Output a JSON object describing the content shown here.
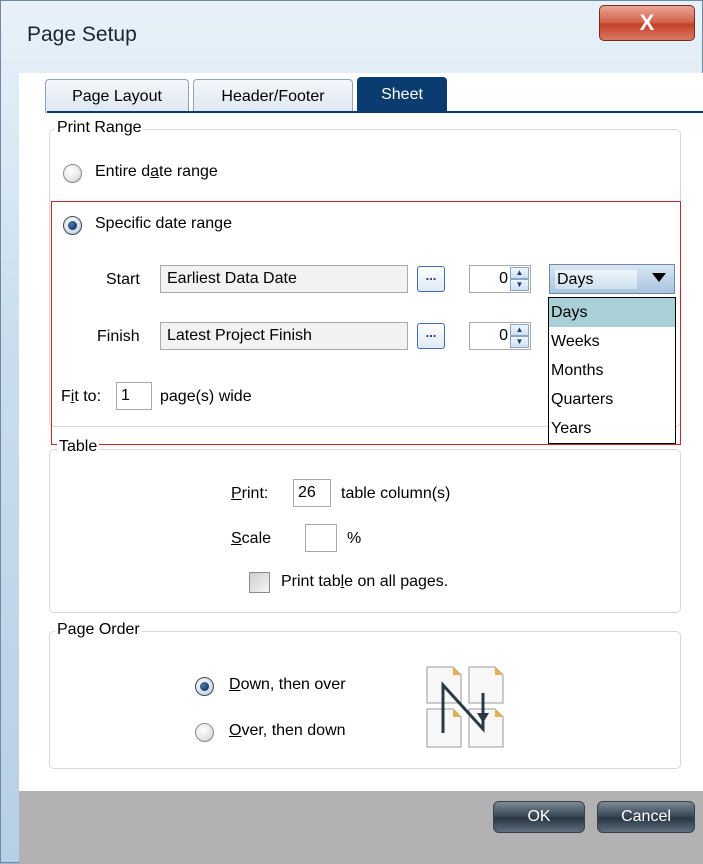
{
  "window": {
    "title": "Page Setup",
    "close_label": "X"
  },
  "tabs": [
    {
      "label": "Page Layout",
      "active": false
    },
    {
      "label": "Header/Footer",
      "active": false
    },
    {
      "label": "Sheet",
      "active": true
    }
  ],
  "print_range": {
    "legend": "Print Range",
    "entire_pre": "Entire d",
    "entire_u": "a",
    "entire_post": "te range",
    "entire_checked": false,
    "specific_label": "Specific date range",
    "specific_checked": true,
    "start_label": "Start",
    "start_value": "Earliest Data Date",
    "start_spin": "0",
    "finish_label": "Finish",
    "finish_value": "Latest Project Finish",
    "finish_spin": "0",
    "ellipsis": "...",
    "unit_selected": "Days",
    "unit_options": [
      "Days",
      "Weeks",
      "Months",
      "Quarters",
      "Years"
    ],
    "fit_pre": "F",
    "fit_u": "i",
    "fit_post": "t to:",
    "fit_value": "1",
    "fit_suffix": "page(s) wide"
  },
  "table": {
    "legend": "Table",
    "print_u": "P",
    "print_post": "rint:",
    "print_value": "26",
    "print_suffix": "table column(s)",
    "scale_u": "S",
    "scale_post": "cale",
    "scale_value": "",
    "scale_suffix": "%",
    "all_pages_pre": "Print tab",
    "all_pages_u": "l",
    "all_pages_post": "e on all pages.",
    "all_pages_checked": false
  },
  "page_order": {
    "legend": "Page Order",
    "down_u": "D",
    "down_post": "own, then over",
    "down_checked": true,
    "over_u": "O",
    "over_post": "ver, then down",
    "over_checked": false
  },
  "buttons": {
    "ok": "OK",
    "cancel": "Cancel"
  },
  "colors": {
    "highlight": "#d1232a",
    "accent": "#0b3c6f"
  }
}
